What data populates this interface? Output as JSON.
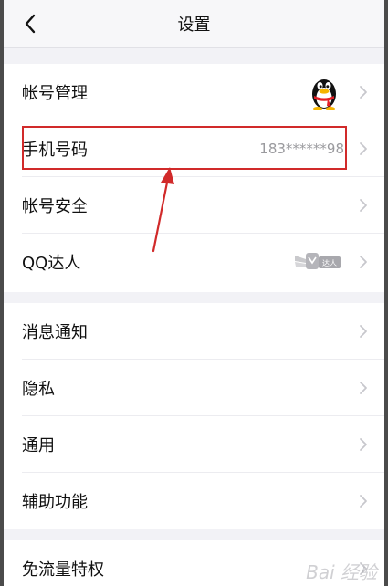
{
  "header": {
    "title": "设置"
  },
  "group1": [
    {
      "label": "帐号管理",
      "value": ""
    },
    {
      "label": "手机号码",
      "value": "183******98"
    },
    {
      "label": "帐号安全",
      "value": ""
    },
    {
      "label": "QQ达人",
      "value": "",
      "badge_text": "达人"
    }
  ],
  "group2": [
    {
      "label": "消息通知"
    },
    {
      "label": "隐私"
    },
    {
      "label": "通用"
    },
    {
      "label": "辅助功能"
    }
  ],
  "group3": [
    {
      "label": "免流量特权"
    }
  ],
  "watermark": {
    "text": "Bai 经验"
  },
  "icons": {
    "back": "chevron-left-icon",
    "row_arrow": "chevron-right-icon",
    "avatar": "qq-penguin-avatar",
    "talent": "qq-talent-badge-icon"
  },
  "colors": {
    "annotation_red": "#d12a2a",
    "background": "#f2f2f6",
    "chevron": "#c7c7cc",
    "secondary_text": "#9a9a9e"
  }
}
